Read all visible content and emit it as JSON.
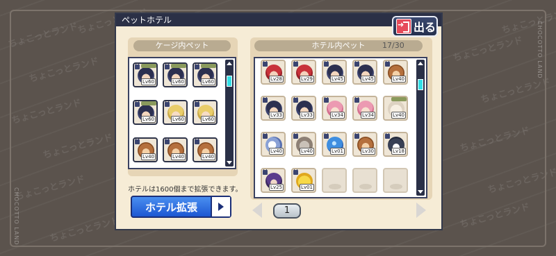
{
  "brand": {
    "text": "CHOCOTTO LAND"
  },
  "watermark": {
    "text": "ちょこっとランド"
  },
  "window": {
    "title": "ペットホテル",
    "exit_label": "出る"
  },
  "cage": {
    "header": "ケージ内ペット",
    "scroll_position": 0.1,
    "pets": [
      {
        "type": "hair-black",
        "level": "Lv60",
        "locked": true,
        "tag": true
      },
      {
        "type": "hair-black",
        "level": "Lv60",
        "locked": true,
        "tag": true
      },
      {
        "type": "hair-black",
        "level": "Lv60",
        "locked": true,
        "tag": true
      },
      {
        "type": "hair-black",
        "level": "Lv60",
        "locked": true,
        "tag": true
      },
      {
        "type": "hair-blonde",
        "level": "Lv60",
        "locked": true,
        "tag": false
      },
      {
        "type": "hair-blonde",
        "level": "Lv60",
        "locked": true,
        "tag": false
      },
      {
        "type": "bear",
        "level": "Lv40",
        "locked": true,
        "tag": false
      },
      {
        "type": "bear",
        "level": "Lv40",
        "locked": true,
        "tag": false
      },
      {
        "type": "bear",
        "level": "Lv40",
        "locked": true,
        "tag": false
      }
    ]
  },
  "hotel": {
    "header": "ホテル内ペット",
    "count": "17/30",
    "scroll_position": 0.1,
    "pets": [
      {
        "type": "hair-red",
        "level": "Lv28",
        "locked": true
      },
      {
        "type": "hair-red",
        "level": "Lv29",
        "locked": true
      },
      {
        "type": "hair-black",
        "level": "Lv45",
        "locked": true
      },
      {
        "type": "hair-black",
        "level": "Lv45",
        "locked": true
      },
      {
        "type": "bear",
        "level": "Lv40",
        "locked": true
      },
      {
        "type": "hair-black",
        "level": "Lv33",
        "locked": true
      },
      {
        "type": "hair-black",
        "level": "Lv33",
        "locked": true
      },
      {
        "type": "hair-pink",
        "level": "Lv34",
        "locked": true
      },
      {
        "type": "hair-pink",
        "level": "Lv34",
        "locked": true
      },
      {
        "type": "lamb",
        "level": "Lv40",
        "locked": false,
        "tag": true
      },
      {
        "type": "bird",
        "level": "Lv40",
        "locked": true
      },
      {
        "type": "goat",
        "level": "Lv40",
        "locked": true
      },
      {
        "type": "slime",
        "level": "Lv01",
        "locked": true
      },
      {
        "type": "bear",
        "level": "Lv30",
        "locked": true
      },
      {
        "type": "penguin",
        "level": "Lv18",
        "locked": true
      },
      {
        "type": "hair-purple",
        "level": "Lv25",
        "locked": true
      },
      {
        "type": "chick",
        "level": "Lv01",
        "locked": true
      },
      {
        "type": "empty"
      },
      {
        "type": "empty"
      },
      {
        "type": "empty"
      }
    ]
  },
  "footer": {
    "note": "ホテルは1600個まで拡張できます。",
    "expand_label": "ホテル拡張"
  },
  "pager": {
    "page": "1"
  },
  "colors": {
    "window_bg": "#f6ecd6",
    "titlebar": "#2b3046",
    "expand_button": "#2f6fe0",
    "scroll_thumb": "#32e0e7"
  }
}
